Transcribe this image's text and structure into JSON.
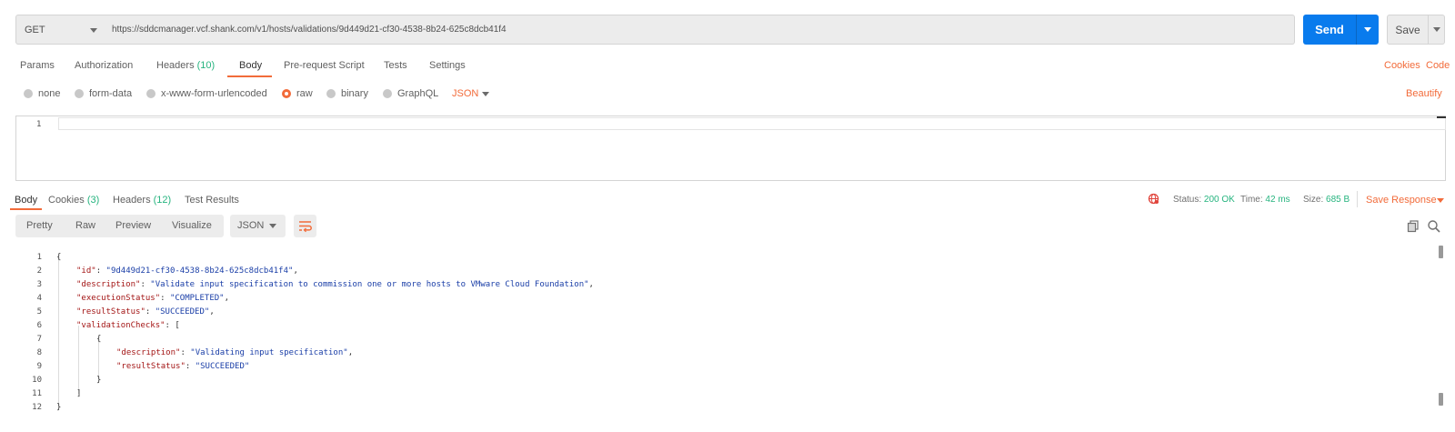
{
  "request": {
    "method": "GET",
    "url": "https://sddcmanager.vcf.shank.com/v1/hosts/validations/9d449d21-cf30-4538-8b24-625c8dcb41f4",
    "send_label": "Send",
    "save_label": "Save"
  },
  "request_tabs": [
    {
      "label": "Params"
    },
    {
      "label": "Authorization"
    },
    {
      "label": "Headers",
      "count": "(10)"
    },
    {
      "label": "Body"
    },
    {
      "label": "Pre-request Script"
    },
    {
      "label": "Tests"
    },
    {
      "label": "Settings"
    }
  ],
  "request_links": {
    "cookies": "Cookies",
    "code": "Code",
    "beautify": "Beautify"
  },
  "body_types": [
    "none",
    "form-data",
    "x-www-form-urlencoded",
    "raw",
    "binary",
    "GraphQL"
  ],
  "body_format": "JSON",
  "editor": {
    "line_number": "1"
  },
  "response_tabs": [
    {
      "label": "Body"
    },
    {
      "label": "Cookies",
      "count": "(3)"
    },
    {
      "label": "Headers",
      "count": "(12)"
    },
    {
      "label": "Test Results"
    }
  ],
  "status": {
    "status_label": "Status:",
    "status_value": "200 OK",
    "time_label": "Time:",
    "time_value": "42 ms",
    "size_label": "Size:",
    "size_value": "685 B",
    "save_response": "Save Response"
  },
  "view_modes": [
    "Pretty",
    "Raw",
    "Preview",
    "Visualize"
  ],
  "response_format": "JSON",
  "response_lines": [
    {
      "n": "1"
    },
    {
      "n": "2"
    },
    {
      "n": "3"
    },
    {
      "n": "4"
    },
    {
      "n": "5"
    },
    {
      "n": "6"
    },
    {
      "n": "7"
    },
    {
      "n": "8"
    },
    {
      "n": "9"
    },
    {
      "n": "10"
    },
    {
      "n": "11"
    },
    {
      "n": "12"
    }
  ],
  "response_json": {
    "k_id": "\"id\"",
    "v_id": "\"9d449d21-cf30-4538-8b24-625c8dcb41f4\"",
    "k_description": "\"description\"",
    "v_description": "\"Validate input specification to commission one or more hosts to VMware Cloud Foundation\"",
    "k_executionStatus": "\"executionStatus\"",
    "v_executionStatus": "\"COMPLETED\"",
    "k_resultStatus": "\"resultStatus\"",
    "v_resultStatus": "\"SUCCEEDED\"",
    "k_validationChecks": "\"validationChecks\"",
    "k_check_description": "\"description\"",
    "v_check_description": "\"Validating input specification\"",
    "k_check_resultStatus": "\"resultStatus\"",
    "v_check_resultStatus": "\"SUCCEEDED\""
  },
  "colors": {
    "accent": "#f26b3a",
    "primary": "#097bed",
    "success": "#26b47f"
  }
}
